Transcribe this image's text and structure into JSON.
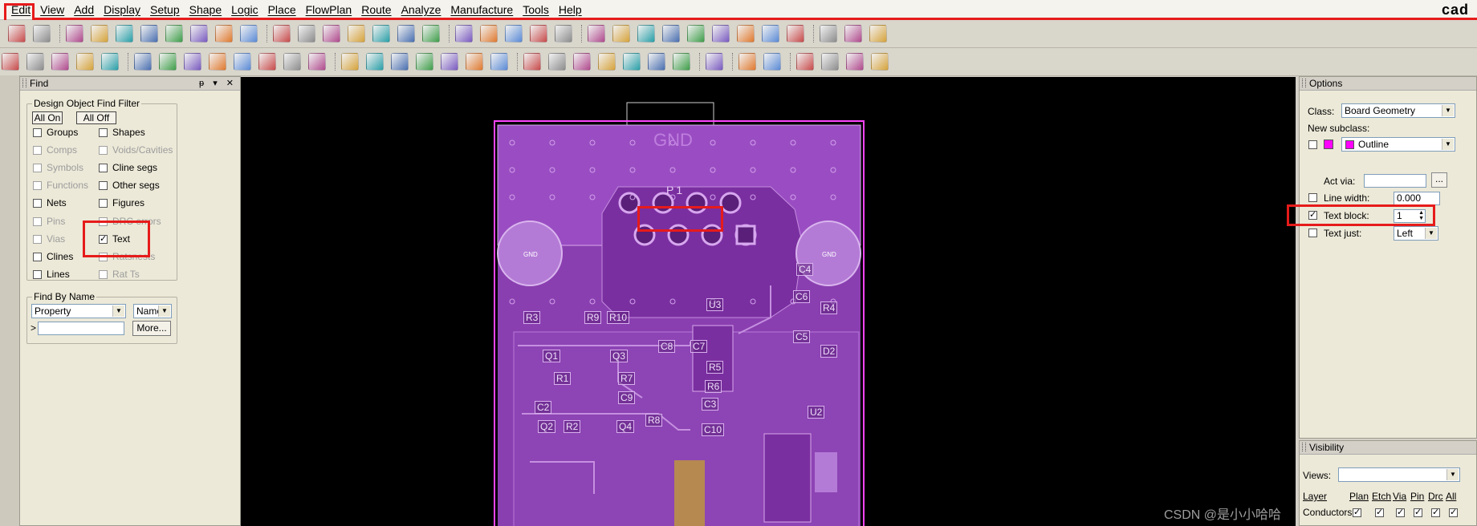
{
  "menu": {
    "items": [
      "Edit",
      "View",
      "Add",
      "Display",
      "Setup",
      "Shape",
      "Logic",
      "Place",
      "FlowPlan",
      "Route",
      "Analyze",
      "Manufacture",
      "Tools",
      "Help"
    ],
    "logo": "cad"
  },
  "find_panel": {
    "title": "Find",
    "filter_legend": "Design Object Find Filter",
    "all_on": "All On",
    "all_off": "All Off",
    "left_items": [
      {
        "label": "Groups",
        "checked": false,
        "enabled": true
      },
      {
        "label": "Comps",
        "checked": false,
        "enabled": false
      },
      {
        "label": "Symbols",
        "checked": false,
        "enabled": false
      },
      {
        "label": "Functions",
        "checked": false,
        "enabled": false
      },
      {
        "label": "Nets",
        "checked": false,
        "enabled": true
      },
      {
        "label": "Pins",
        "checked": false,
        "enabled": false
      },
      {
        "label": "Vias",
        "checked": false,
        "enabled": false
      },
      {
        "label": "Clines",
        "checked": false,
        "enabled": true
      },
      {
        "label": "Lines",
        "checked": false,
        "enabled": true
      }
    ],
    "right_items": [
      {
        "label": "Shapes",
        "checked": false,
        "enabled": true
      },
      {
        "label": "Voids/Cavities",
        "checked": false,
        "enabled": false
      },
      {
        "label": "Cline segs",
        "checked": false,
        "enabled": true
      },
      {
        "label": "Other segs",
        "checked": false,
        "enabled": true
      },
      {
        "label": "Figures",
        "checked": false,
        "enabled": true
      },
      {
        "label": "DRC errors",
        "checked": false,
        "enabled": false
      },
      {
        "label": "Text",
        "checked": true,
        "enabled": true
      },
      {
        "label": "Ratsnests",
        "checked": false,
        "enabled": false
      },
      {
        "label": "Rat Ts",
        "checked": false,
        "enabled": false
      }
    ],
    "find_by_name_legend": "Find By Name",
    "type_select": "Property",
    "name_select": "Name",
    "arrow": ">",
    "name_value": "",
    "more_button": "More..."
  },
  "options_panel": {
    "title": "Options",
    "class_label": "Class:",
    "class_value": "Board Geometry",
    "new_subclass_label": "New subclass:",
    "subclass_value": "Outline",
    "subclass_color": "#ff00ff",
    "act_via_label": "Act via:",
    "act_via_value": "",
    "act_via_button": "...",
    "line_width_label": "Line width:",
    "line_width_value": "0.000",
    "text_block_label": "Text block:",
    "text_block_value": "1",
    "text_block_checked": true,
    "text_just_label": "Text just:",
    "text_just_value": "Left"
  },
  "visibility_panel": {
    "title": "Visibility",
    "views_label": "Views:",
    "views_value": "",
    "columns": [
      "Layer",
      "Plan",
      "Etch",
      "Via",
      "Pin",
      "Drc",
      "All"
    ],
    "row_label": "Conductors"
  },
  "board": {
    "gnd_label": "GND",
    "connector_ref": "P1",
    "mount_hole_label": "GND",
    "components": [
      "C4",
      "U3",
      "C6",
      "R4",
      "R3",
      "R9",
      "R10",
      "C5",
      "D2",
      "Q1",
      "Q3",
      "C8",
      "C7",
      "R5",
      "R1",
      "R7",
      "R6",
      "C9",
      "C3",
      "U2",
      "C10",
      "R2",
      "Q4",
      "R8",
      "C2",
      "Q2"
    ],
    "watermark": "CSDN @是小小哈哈"
  },
  "colors": {
    "board": "#8a3fb0",
    "board_light": "#a65ccf",
    "outline": "#ff44ff",
    "highlight": "#e61b1b"
  }
}
